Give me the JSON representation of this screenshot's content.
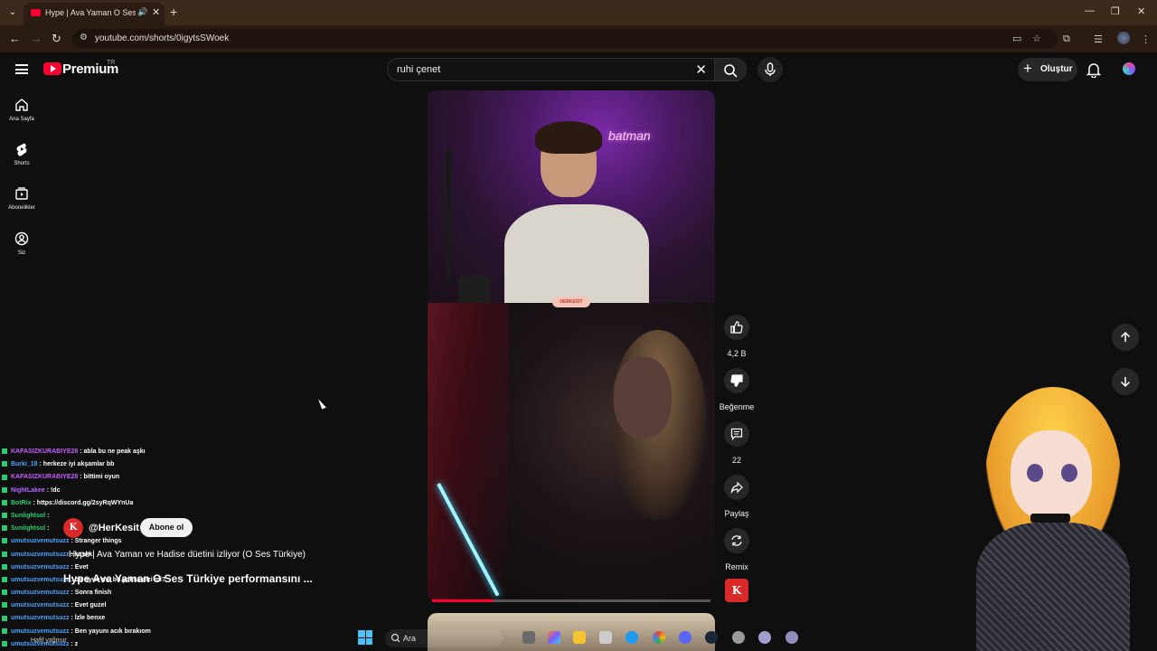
{
  "browser": {
    "tab_title": "Hype | Ava Yaman O Ses Türkiye",
    "url": "youtube.com/shorts/0igytsSWoek"
  },
  "header": {
    "brand": "Premium",
    "region": "TR",
    "search_value": "ruhi çenet",
    "create_label": "Oluştur"
  },
  "guide": [
    {
      "label": "Ana Sayfa"
    },
    {
      "label": "Shorts"
    },
    {
      "label": "Abonelikler"
    },
    {
      "label": "Siz"
    }
  ],
  "actions": {
    "like_count": "4,2 B",
    "dislike_label": "Beğenme",
    "comment_count": "22",
    "share_label": "Paylaş",
    "remix_label": "Remix"
  },
  "video": {
    "progress": 0.22,
    "neon_text": "batman",
    "split_badge": "HERKESİT"
  },
  "short_info": {
    "channel_avatar": "K",
    "channel": "@HerKesit",
    "subscribe_label": "Abone ol",
    "music": "Hype | Ava Yaman ve Hadise düetini izliyor (O Ses Türkiye)",
    "title": "Hype Ava Yaman O Ses Türkiye performansını ..."
  },
  "chat": [
    {
      "user": "KAFASIZKURABIYE28",
      "msg": ": abla bu ne peak aşkı",
      "color": "#c65cff"
    },
    {
      "user": "Burki_18",
      "msg": ": herkeze iyi akşamlar bb",
      "color": "#4aa3ff"
    },
    {
      "user": "KAFASIZKURABIYE28",
      "msg": ": bittimi oyun",
      "color": "#c65cff"
    },
    {
      "user": "NightLakee",
      "msg": ": !dc",
      "color": "#b36bff"
    },
    {
      "user": "BotRix",
      "msg": ": https://discord.gg/2syRqWYnUa",
      "color": "#2ecc71"
    },
    {
      "user": "Sunlightsol",
      "msg": ":",
      "color": "#2ecc71"
    },
    {
      "user": "Sunlightsol",
      "msg": ":",
      "color": "#2ecc71"
    },
    {
      "user": "umutsuzvemutsuzz",
      "msg": ": Stranger things",
      "color": "#4aa3ff"
    },
    {
      "user": "umutsuzvemutsuzz",
      "msg": ": kaskk",
      "color": "#4aa3ff"
    },
    {
      "user": "umutsuzvemutsuzz",
      "msg": ": Evet",
      "color": "#4aa3ff"
    },
    {
      "user": "umutsuzvemutsuzz",
      "msg": ": bir oyun mu bu yoksa dizi mi?",
      "color": "#4aa3ff"
    },
    {
      "user": "umutsuzvemutsuzz",
      "msg": ": Sonra finish",
      "color": "#4aa3ff"
    },
    {
      "user": "umutsuzvemutsuzz",
      "msg": ": Evet guzel",
      "color": "#4aa3ff"
    },
    {
      "user": "umutsuzvemutsuzz",
      "msg": ": İzle benxe",
      "color": "#4aa3ff"
    },
    {
      "user": "umutsuzvemutsuzz",
      "msg": ": Ben yayunı acık bırakıom",
      "color": "#4aa3ff"
    },
    {
      "user": "umutsuzvemutsuzz",
      "msg": ": z",
      "color": "#4aa3ff"
    }
  ],
  "taskbar": {
    "search_label": "Ara",
    "weather": "Hafif yağmur"
  },
  "colors": {
    "accent": "#ff0033",
    "background": "#0f0f0f"
  }
}
